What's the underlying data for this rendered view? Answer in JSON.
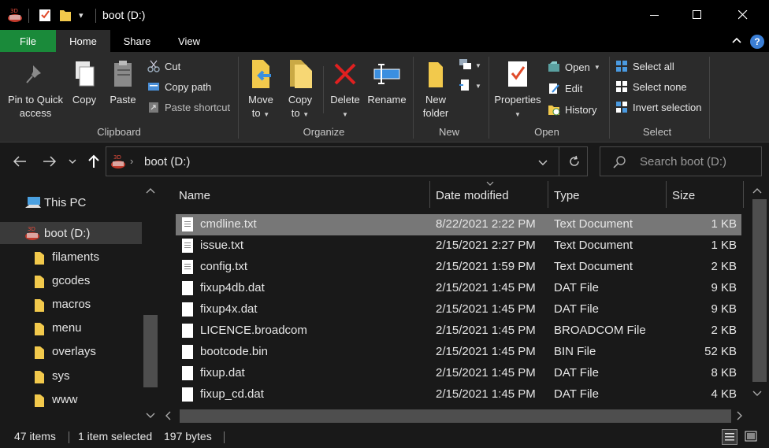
{
  "titlebar": {
    "title": "boot (D:)",
    "customize_caret": "▾"
  },
  "tabs": {
    "file": "File",
    "home": "Home",
    "share": "Share",
    "view": "View"
  },
  "ribbon": {
    "clipboard": {
      "label": "Clipboard",
      "pin": "Pin to Quick access",
      "pin_l1": "Pin to Quick",
      "pin_l2": "access",
      "copy": "Copy",
      "paste": "Paste",
      "cut": "Cut",
      "copy_path": "Copy path",
      "paste_shortcut": "Paste shortcut"
    },
    "organize": {
      "label": "Organize",
      "move_l1": "Move",
      "move_l2": "to",
      "copy_l1": "Copy",
      "copy_l2": "to",
      "delete": "Delete",
      "rename": "Rename"
    },
    "new": {
      "label": "New",
      "nf_l1": "New",
      "nf_l2": "folder"
    },
    "open": {
      "label": "Open",
      "properties": "Properties",
      "open": "Open",
      "edit": "Edit",
      "history": "History"
    },
    "select": {
      "label": "Select",
      "all": "Select all",
      "none": "Select none",
      "invert": "Invert selection"
    }
  },
  "address": {
    "path": "boot (D:)",
    "search_placeholder": "Search boot (D:)"
  },
  "nav": {
    "items": [
      {
        "label": "This PC"
      },
      {
        "label": "boot (D:)"
      },
      {
        "label": "filaments"
      },
      {
        "label": "gcodes"
      },
      {
        "label": "macros"
      },
      {
        "label": "menu"
      },
      {
        "label": "overlays"
      },
      {
        "label": "sys"
      },
      {
        "label": "www"
      }
    ]
  },
  "files": {
    "columns": [
      "Name",
      "Date modified",
      "Type",
      "Size"
    ],
    "rows": [
      {
        "name": "cmdline.txt",
        "date": "8/22/2021 2:22 PM",
        "type": "Text Document",
        "size": "1 KB"
      },
      {
        "name": "issue.txt",
        "date": "2/15/2021 2:27 PM",
        "type": "Text Document",
        "size": "1 KB"
      },
      {
        "name": "config.txt",
        "date": "2/15/2021 1:59 PM",
        "type": "Text Document",
        "size": "2 KB"
      },
      {
        "name": "fixup4db.dat",
        "date": "2/15/2021 1:45 PM",
        "type": "DAT File",
        "size": "9 KB"
      },
      {
        "name": "fixup4x.dat",
        "date": "2/15/2021 1:45 PM",
        "type": "DAT File",
        "size": "9 KB"
      },
      {
        "name": "LICENCE.broadcom",
        "date": "2/15/2021 1:45 PM",
        "type": "BROADCOM File",
        "size": "2 KB"
      },
      {
        "name": "bootcode.bin",
        "date": "2/15/2021 1:45 PM",
        "type": "BIN File",
        "size": "52 KB"
      },
      {
        "name": "fixup.dat",
        "date": "2/15/2021 1:45 PM",
        "type": "DAT File",
        "size": "8 KB"
      },
      {
        "name": "fixup_cd.dat",
        "date": "2/15/2021 1:45 PM",
        "type": "DAT File",
        "size": "4 KB"
      }
    ]
  },
  "status": {
    "items": "47 items",
    "selected": "1 item selected",
    "size": "197 bytes"
  },
  "colors": {
    "file_tab": "#1a8a3a",
    "selection": "#777777",
    "folder": "#f2c94c"
  }
}
